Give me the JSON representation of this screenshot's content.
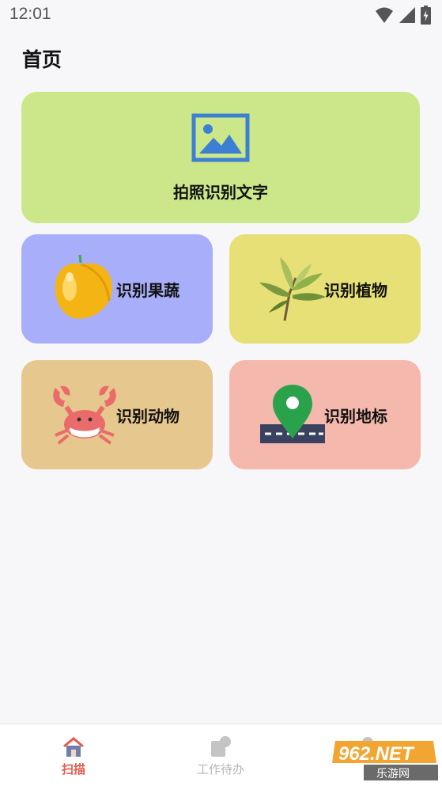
{
  "status_bar": {
    "time": "12:01"
  },
  "page": {
    "title": "首页"
  },
  "cards": {
    "photo_text": {
      "label": "拍照识别文字",
      "icon": "image-icon"
    },
    "fruit": {
      "label": "识别果蔬",
      "icon": "peach-icon"
    },
    "plant": {
      "label": "识别植物",
      "icon": "leaf-icon"
    },
    "animal": {
      "label": "识别动物",
      "icon": "crab-icon"
    },
    "landmark": {
      "label": "识别地标",
      "icon": "map-pin-icon"
    }
  },
  "tabs": [
    {
      "label": "扫描",
      "icon": "home-icon",
      "active": true
    },
    {
      "label": "工作待办",
      "icon": "todo-icon",
      "active": false
    },
    {
      "label": "",
      "icon": "user-icon",
      "active": false
    }
  ],
  "watermark": {
    "brand": "962.NET",
    "subtitle": "乐游网"
  },
  "colors": {
    "background": "#f7f7f9",
    "photo_card": "#cbe78a",
    "fruit_card": "#a8aef9",
    "plant_card": "#e7e077",
    "animal_card": "#e6c78e",
    "landmark_card": "#f4b8ad",
    "active_tab": "#e55a4e"
  }
}
